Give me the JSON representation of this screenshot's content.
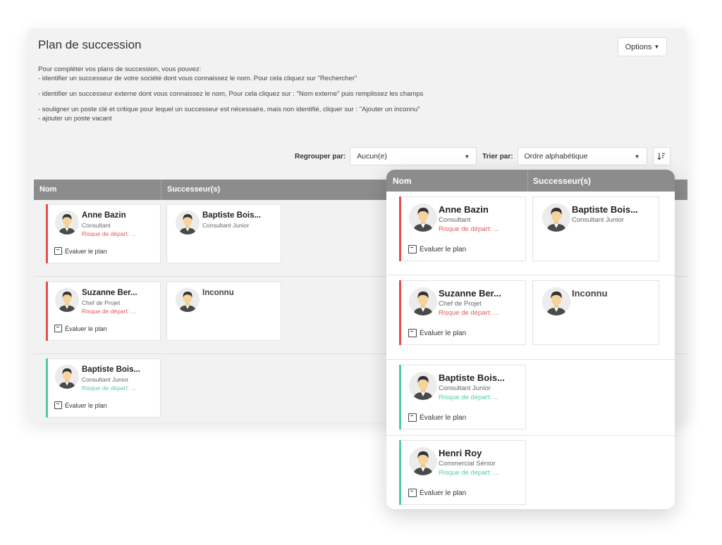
{
  "page": {
    "title": "Plan de succession",
    "options_label": "Options",
    "intro_lines": [
      "Pour compléter vos plans de succession, vous pouvez:",
      "- identifier un successeur de votre société dont vous connaissez le nom. Pour cela cliquez sur \"Rechercher\"",
      "- identifier un successeur externe dont vous connaissez le nom, Pour cela cliquez sur : \"Nom externe\" puis remplissez les champs",
      "- souligner un poste clé et critique pour lequel un successeur est nécessaire, mais non identifié, cliquer sur : \"Ajouter un inconnu\"",
      "- ajouter un poste vacant"
    ]
  },
  "controls": {
    "group_label": "Regrouper par:",
    "group_value": "Aucun(e)",
    "sort_label": "Trier par:",
    "sort_value": "Ordre alphabétique",
    "sort_icon": "sort-descending-icon"
  },
  "table": {
    "col_name": "Nom",
    "col_successors": "Successeur(s)"
  },
  "eval_label": "Évaluer le plan",
  "rows": [
    {
      "name": "Anne Bazin",
      "role": "Consultant",
      "risk": "Risque de départ: ...",
      "risk_color": "#e84d4d",
      "successor": {
        "name": "Baptiste Bois...",
        "role": "Consultant Junior"
      }
    },
    {
      "name": "Suzanne Ber...",
      "role": "Chef de Projet",
      "risk": "Risque de départ: ...",
      "risk_color": "#e84d4d",
      "successor": {
        "name": "Inconnu",
        "role": ""
      }
    },
    {
      "name": "Baptiste Bois...",
      "role": "Consultant Junior",
      "risk": "Risque de départ: ...",
      "risk_color": "#4fcba6",
      "successor": null
    },
    {
      "name": "Henri Roy",
      "role": "Commercial Sénior",
      "risk": "Risque de départ: ...",
      "risk_color": "#4fcba6",
      "successor": null
    }
  ]
}
